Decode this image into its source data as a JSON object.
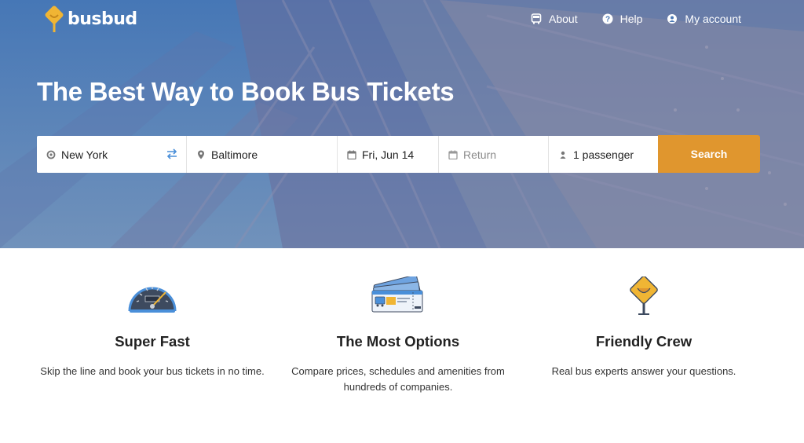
{
  "brand": {
    "name": "busbud"
  },
  "nav": {
    "items": [
      {
        "label": "About",
        "icon": "bus-icon"
      },
      {
        "label": "Help",
        "icon": "question-icon"
      },
      {
        "label": "My account",
        "icon": "user-icon"
      }
    ]
  },
  "hero": {
    "title": "The Best Way to Book Bus Tickets"
  },
  "search": {
    "origin": "New York",
    "destination": "Baltimore",
    "date": "Fri, Jun 14",
    "return_placeholder": "Return",
    "passengers": "1 passenger",
    "button_label": "Search"
  },
  "features": [
    {
      "title": "Super Fast",
      "text": "Skip the line and book your bus tickets in no time.",
      "icon": "speedometer-icon"
    },
    {
      "title": "The Most Options",
      "text": "Compare prices, schedules and amenities from hundreds of companies.",
      "icon": "tickets-icon"
    },
    {
      "title": "Friendly Crew",
      "text": "Real bus experts answer your questions.",
      "icon": "smiley-sign-icon"
    }
  ],
  "colors": {
    "hero_blue": "#4a78b4",
    "accent_orange": "#e0962e",
    "logo_yellow": "#f0b534",
    "swap_blue": "#4a8fd9"
  }
}
